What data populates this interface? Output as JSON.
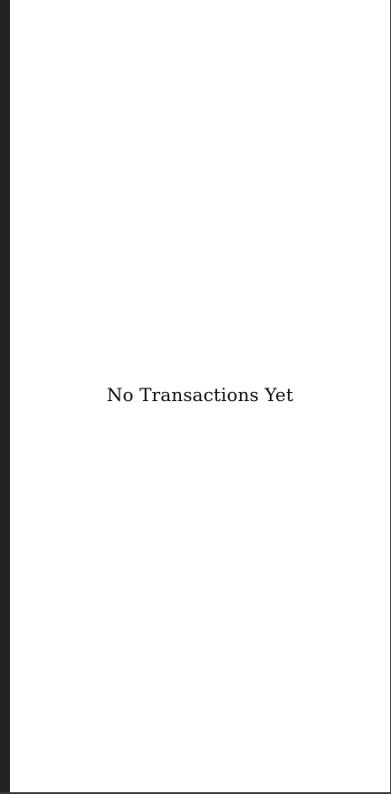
{
  "transactions": {
    "empty_message": "No Transactions Yet"
  },
  "colors": {
    "rail": "#232323",
    "background": "#ffffff",
    "text": "#111111"
  }
}
